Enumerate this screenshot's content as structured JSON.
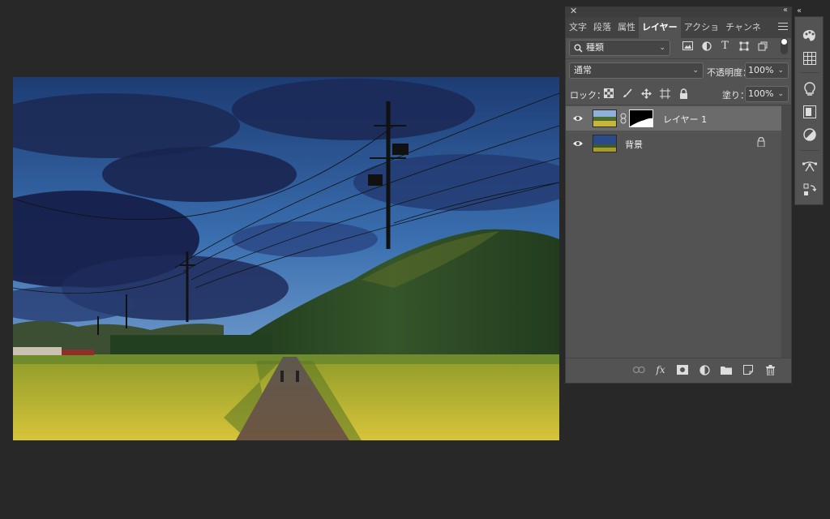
{
  "panel": {
    "tabs": [
      {
        "label": "文字"
      },
      {
        "label": "段落"
      },
      {
        "label": "属性"
      },
      {
        "label": "レイヤー"
      },
      {
        "label": "アクショ"
      },
      {
        "label": "チャンネ"
      }
    ],
    "active_tab": 3,
    "filter": {
      "kind_label": "種類"
    },
    "blend": {
      "mode": "通常",
      "opacity_label": "不透明度：",
      "opacity_value": "100%"
    },
    "lock": {
      "label": "ロック：",
      "fill_label": "塗り：",
      "fill_value": "100%"
    },
    "layers": [
      {
        "name": "レイヤー 1",
        "selected": true,
        "has_mask": true
      },
      {
        "name": "背景",
        "selected": false,
        "locked": true
      }
    ]
  },
  "icons": {
    "filter": [
      "image-filter-icon",
      "adjustment-filter-icon",
      "type-filter-icon",
      "shape-filter-icon",
      "smartobject-filter-icon"
    ],
    "lock": [
      "lock-transparent-icon",
      "lock-paint-icon",
      "lock-position-icon",
      "lock-artboard-icon",
      "lock-all-icon"
    ],
    "footer": [
      "link-layers-icon",
      "fx-icon",
      "add-mask-icon",
      "new-adjustment-icon",
      "new-group-icon",
      "new-layer-icon",
      "delete-layer-icon"
    ],
    "toolbar": [
      "color-palette-icon",
      "swatches-grid-icon",
      "light-bulb-icon",
      "libraries-icon",
      "adjustments-icon",
      "paths-icon",
      "history-icon"
    ]
  },
  "colors": {
    "bg": "#282828",
    "panel": "#535353",
    "selected_row": "#6b6b6b"
  }
}
